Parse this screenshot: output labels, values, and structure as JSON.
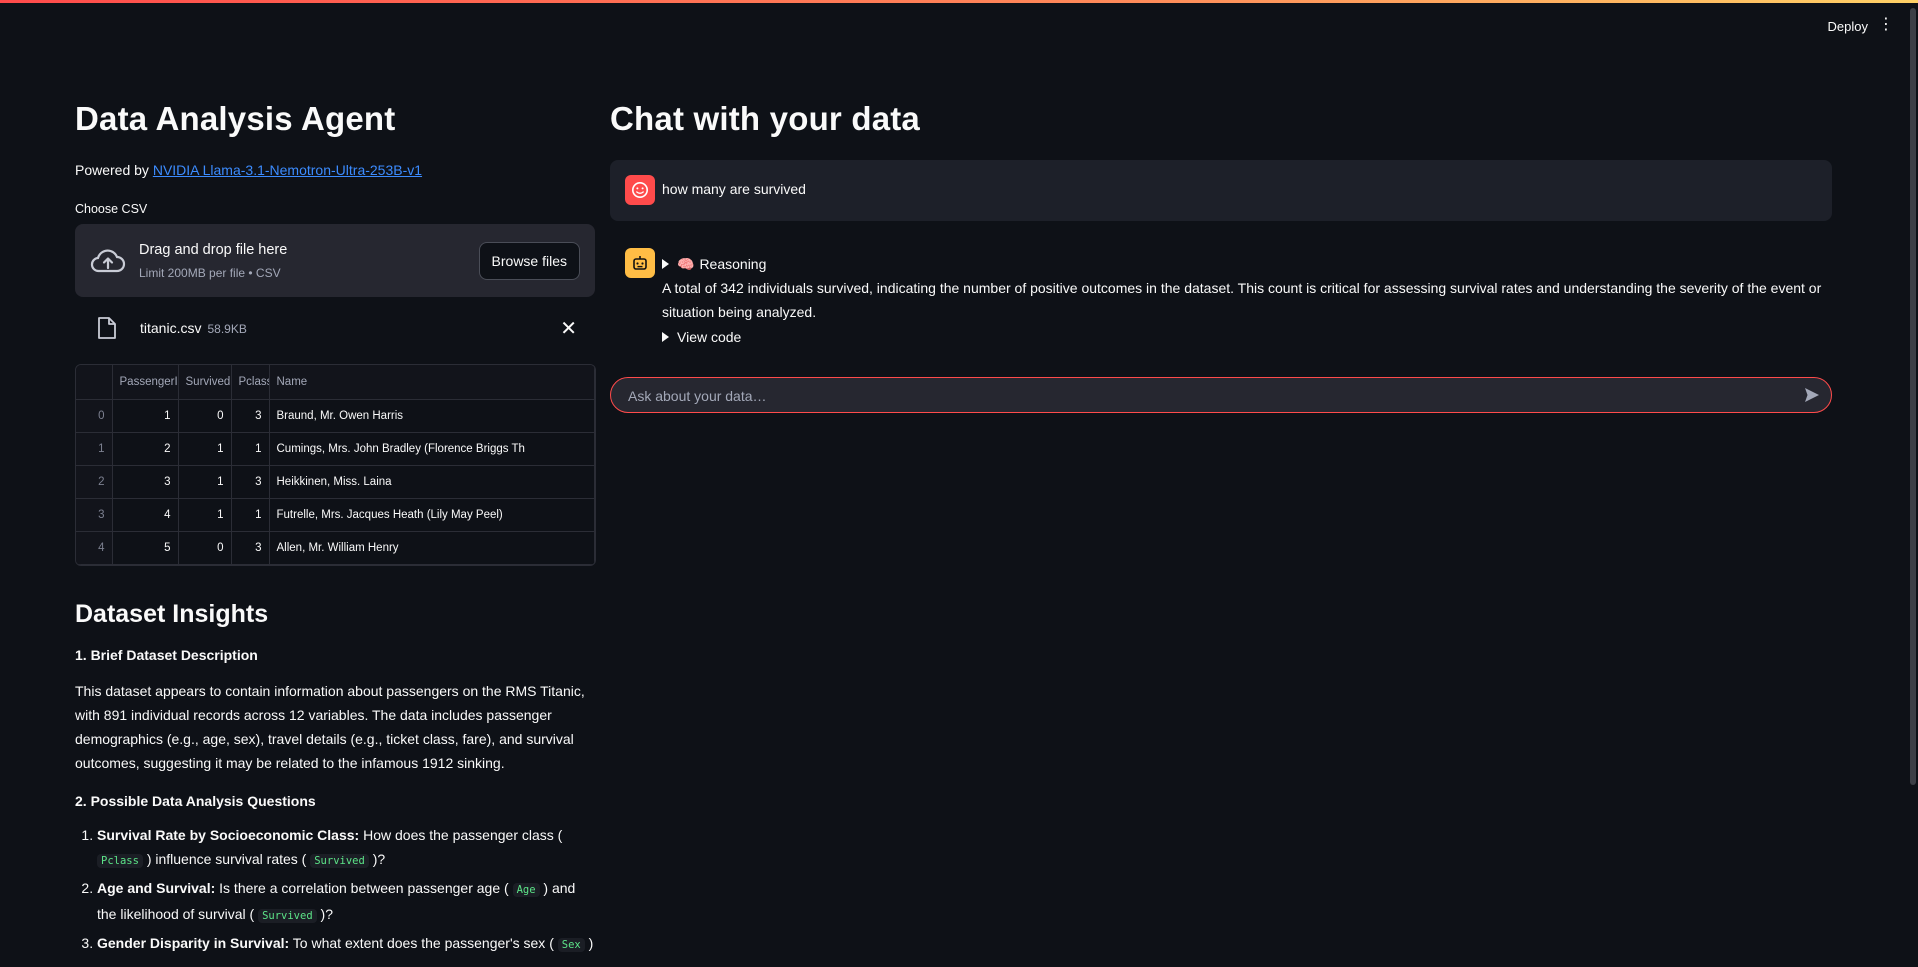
{
  "header": {
    "deploy_label": "Deploy",
    "menu_glyph": "⋮"
  },
  "left": {
    "title": "Data Analysis Agent",
    "powered_prefix": "Powered by ",
    "powered_link": "NVIDIA Llama-3.1-Nemotron-Ultra-253B-v1",
    "choose_label": "Choose CSV",
    "uploader": {
      "title": "Drag and drop file here",
      "subtitle": "Limit 200MB per file • CSV",
      "browse_label": "Browse files"
    },
    "file": {
      "name": "titanic.csv",
      "size": "58.9KB",
      "close_glyph": "✕"
    },
    "table": {
      "columns": [
        "",
        "PassengerId",
        "Survived",
        "Pclass",
        "Name"
      ],
      "rows": [
        [
          "0",
          "1",
          "0",
          "3",
          "Braund, Mr. Owen Harris"
        ],
        [
          "1",
          "2",
          "1",
          "1",
          "Cumings, Mrs. John Bradley (Florence Briggs Th"
        ],
        [
          "2",
          "3",
          "1",
          "3",
          "Heikkinen, Miss. Laina"
        ],
        [
          "3",
          "4",
          "1",
          "1",
          "Futrelle, Mrs. Jacques Heath (Lily May Peel)"
        ],
        [
          "4",
          "5",
          "0",
          "3",
          "Allen, Mr. William Henry"
        ]
      ]
    },
    "insights": {
      "title": "Dataset Insights",
      "h1": "1. Brief Dataset Description",
      "description": "This dataset appears to contain information about passengers on the RMS Titanic, with 891 individual records across 12 variables. The data includes passenger demographics (e.g., age, sex), travel details (e.g., ticket class, fare), and survival outcomes, suggesting it may be related to the infamous 1912 sinking.",
      "h2": "2. Possible Data Analysis Questions",
      "q1": {
        "bold": "Survival Rate by Socioeconomic Class:",
        "t1": " How does the passenger class ( ",
        "c1": "Pclass",
        "t2": " ) influence survival rates ( ",
        "c2": "Survived",
        "t3": " )?"
      },
      "q2": {
        "bold": "Age and Survival:",
        "t1": " Is there a correlation between passenger age ( ",
        "c1": "Age",
        "t2": " ) and the likelihood of survival ( ",
        "c2": "Survived",
        "t3": " )?"
      },
      "q3": {
        "bold": "Gender Disparity in Survival:",
        "t1": " To what extent does the passenger's sex ( ",
        "c1": "Sex",
        "t2": " )"
      }
    }
  },
  "right": {
    "title": "Chat with your data",
    "user_message": "how many are survived",
    "reasoning_label": "Reasoning",
    "brain_glyph": "🧠",
    "answer": "A total of 342 individuals survived, indicating the number of positive outcomes in the dataset. This count is critical for assessing survival rates and understanding the severity of the event or situation being analyzed.",
    "view_code_label": "View code",
    "input_placeholder": "Ask about your data…"
  },
  "colors": {
    "background": "#0e1117",
    "accent": "#ff4b4b",
    "link": "#3c8cff",
    "bot_avatar": "#ffbd45",
    "code": "#5ce488"
  }
}
